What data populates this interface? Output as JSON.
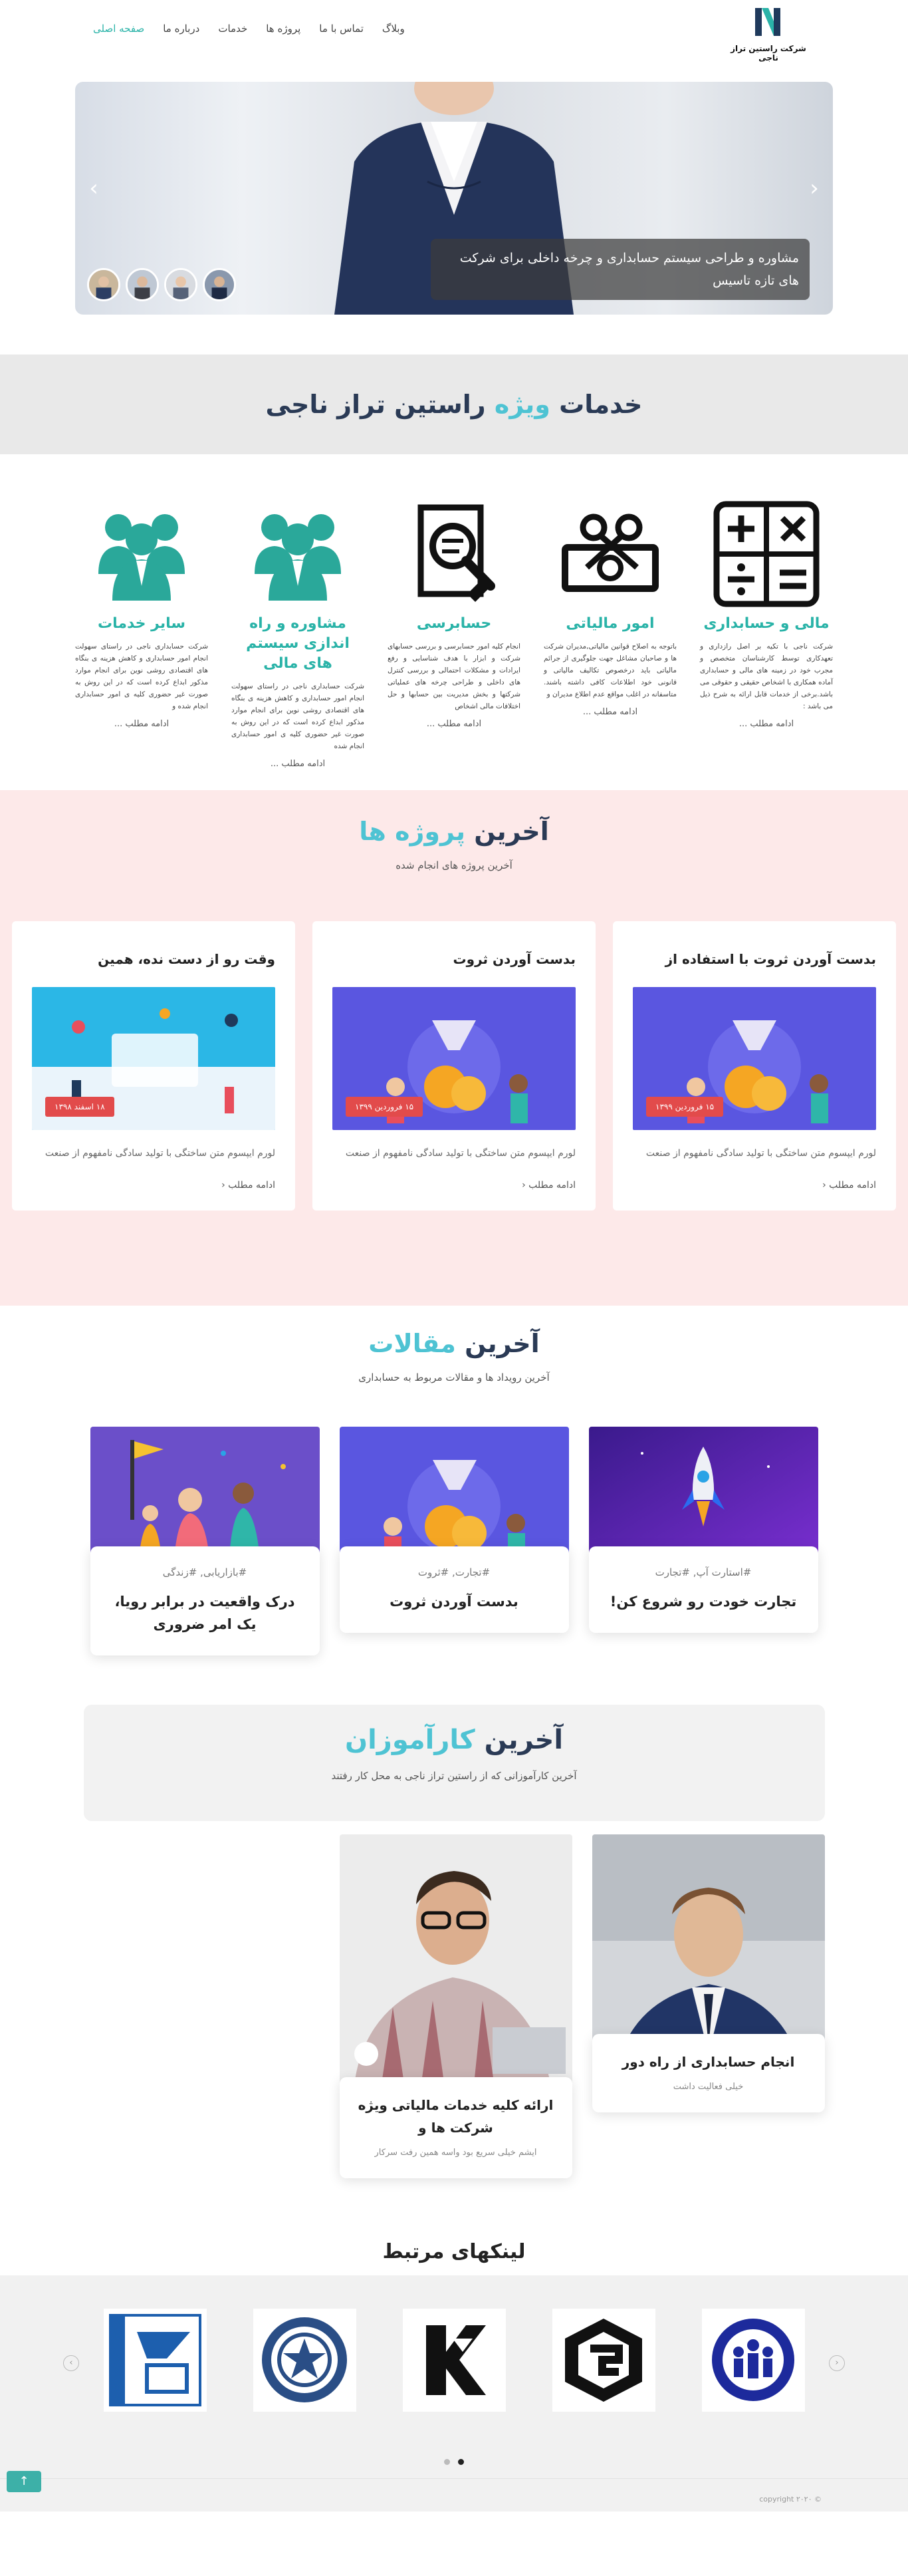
{
  "brand": {
    "name": "شرکت راستین تراز ناجی"
  },
  "nav": [
    {
      "label": "صفحه اصلی",
      "active": true
    },
    {
      "label": "درباره ما"
    },
    {
      "label": "خدمات"
    },
    {
      "label": "پروژه ها"
    },
    {
      "label": "تماس با ما"
    },
    {
      "label": "وبلاگ"
    }
  ],
  "hero": {
    "caption": "مشاوره و طراحی سیستم حسابداری و چرخه داخلی برای شرکت های تازه تاسیس",
    "prev_icon": "‹",
    "next_icon": "›"
  },
  "services": {
    "title_a": "خدمات",
    "title_b": "ویژه",
    "title_c": "راستین تراز ناجی",
    "items": [
      {
        "icon": "calculator-icon",
        "title": "مالی و حسابداری",
        "text": "شرکت ناجی با تکیه بر اصل رازداری و تعهدکاری توسط کارشناسان متخصص و مجرب خود در زمینه های مالی و حسابداری آماده همکاری با اشخاص حقیقی و حقوقی می باشد.برخی از خدمات قابل ارائه به شرح ذیل می باشد :",
        "more": "ادامه مطلب ..."
      },
      {
        "icon": "tax-icon",
        "title": "امور مالیاتی",
        "text": "باتوجه به اصلاح قوانین مالیاتی,مدیران شرکت ها و صاحبان مشاغل جهت جلوگیری از جرائم مالیاتی باید درخصوص تکالیف مالیاتی و قانونی خود اطلاعات کافی داشته باشند. متاسفانه در اغلب مواقع عدم اطلاع مدیران و",
        "more": "ادامه مطلب ..."
      },
      {
        "icon": "audit-icon",
        "title": "حسابرسی",
        "text": "انجام کلیه امور حسابرسی و بررسی حسابهای شرکت و ابزار با هدف شناسایی و رفع ایرادات و مشکلات احتمالی و بررسی کنترل های داخلی و طراحی چرخه های عملیاتی شرکتها و بخش مدیریت بین حسابها و حل اختلافات مالی اشخاص",
        "more": "ادامه مطلب ..."
      },
      {
        "icon": "consultants-icon",
        "title": "مشاوره و راه اندازی سیستم های مالی",
        "text": "شرکت حسابداری ناجی در راستای سهولت انجام امور حسابداری و کاهش هزینه ی بنگاه های اقتصادی روشی نوین برای انجام موارد مذکور ابداع کرده است که در این روش به صورت غیر حضوری کلیه ی امور حسابداری انجام شده",
        "more": "ادامه مطلب ..."
      },
      {
        "icon": "team-icon",
        "title": "سایر خدمات",
        "text": "شرکت حسابداری ناجی در راستای سهولت انجام امور حسابداری و کاهش هزینه ی بنگاه های اقتصادی روشی نوین برای انجام موارد مذکور ابداع کرده است که در این روش به صورت غیر حضوری کلیه ی امور حسابداری انجام شده و",
        "more": "ادامه مطلب ..."
      }
    ]
  },
  "projects": {
    "title_a": "آخرین",
    "title_b": "پروژه ها",
    "subtitle": "آخرین پروژه های انجام شده",
    "items": [
      {
        "title": "بدست آوردن ثروت با استفاده از",
        "date": "۱۵ فروردین ۱۳۹۹",
        "text": "لورم ایپسوم متن ساختگی با تولید سادگی نامفهوم از صنعت",
        "more": "ادامه مطلب"
      },
      {
        "title": "بدست آوردن ثروت",
        "date": "۱۵ فروردین ۱۳۹۹",
        "text": "لورم ایپسوم متن ساختگی با تولید سادگی نامفهوم از صنعت",
        "more": "ادامه مطلب"
      },
      {
        "title": "وقت رو از دست نده، همین",
        "date": "۱۸ اسفند ۱۳۹۸",
        "text": "لورم ایپسوم متن ساختگی با تولید سادگی نامفهوم از صنعت",
        "more": "ادامه مطلب"
      }
    ]
  },
  "articles": {
    "title_a": "آخرین",
    "title_b": "مقالات",
    "subtitle": "آخرین رویداد ها و مقالات مربوط به حسابداری",
    "items": [
      {
        "tags": "#استارت آپ, #تجارت",
        "title": "تجارت خودت رو شروع کن!"
      },
      {
        "tags": "#تجارت, #ثروت",
        "title": "بدست آوردن ثروت"
      },
      {
        "tags": "#بازاریابی, #زندگی",
        "title": "درک واقعیت در برابر رویا، یک امر ضروری"
      }
    ]
  },
  "trainees": {
    "title_a": "آخرین",
    "title_b": "کارآموزان",
    "subtitle": "آخرین کارآموزانی که از راستین تراز ناجی به محل کار رفتند",
    "items": [
      {
        "title": "انجام حسابداری از راه دور",
        "sub": "خیلی فعالیت داشت"
      },
      {
        "title": "ارائه کلیه خدمات مالیاتی ویژه شرکت ها و",
        "sub": "ایشم خیلی سریع بود واسه همین رفت سرکار"
      }
    ]
  },
  "links": {
    "title": "لینکهای مرتبط",
    "prev": "‹",
    "next": "›"
  },
  "footer": {
    "copyright": "copyright ۲۰۲۰ ©",
    "to_top": "↑"
  },
  "colors": {
    "accent": "#4ec3d3",
    "teal": "#2ab3a8",
    "badge": "#e24b4b"
  }
}
